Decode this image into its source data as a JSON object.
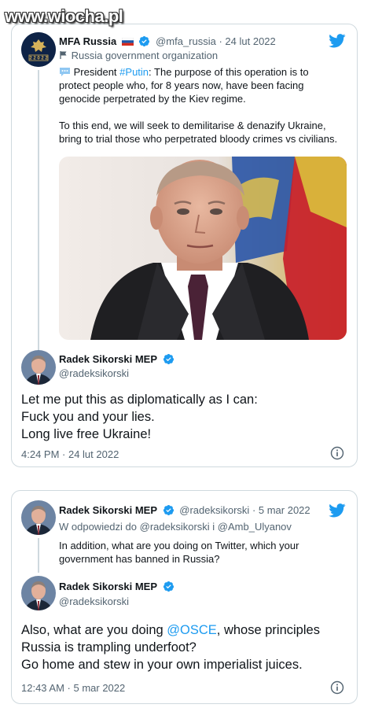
{
  "watermark": "www.wiocha.pl",
  "card1": {
    "quoted": {
      "name": "MFA Russia",
      "handle": "@mfa_russia",
      "date": "· 24 lut 2022",
      "label": "Russia government organization",
      "line1_prefix": "President ",
      "hashtag": "#Putin",
      "line1_suffix": ": The purpose of this operation is to",
      "line2": "protect people who, for 8 years now, have been facing",
      "line3": "genocide perpetrated by the Kiev regime.",
      "line4": "To this end, we will seek to demilitarise & denazify Ukraine,",
      "line5": "bring to trial those who perpetrated bloody crimes vs civilians."
    },
    "reply": {
      "name": "Radek Sikorski MEP",
      "handle": "@radeksikorski",
      "line1": "Let me put this as diplomatically as I can:",
      "line2": "Fuck you and your lies.",
      "line3": "Long live free Ukraine!",
      "timestamp": "4:24 PM · 24 lut 2022"
    }
  },
  "card2": {
    "quoted": {
      "name": "Radek Sikorski MEP",
      "handle": "@radeksikorski",
      "date": "· 5 mar 2022",
      "replying_prefix": "W odpowiedzi do ",
      "replying_handles": "@radeksikorski i @Amb_Ulyanov",
      "line1": "In addition, what are you doing on Twitter, which your",
      "line2": "government has banned in Russia?"
    },
    "reply": {
      "name": "Radek Sikorski MEP",
      "handle": "@radeksikorski",
      "line1_prefix": "Also, what are you doing ",
      "mention": "@OSCE",
      "line1_suffix": ", whose principles",
      "line2": "Russia is trampling underfoot?",
      "line3": "Go home and stew in your own imperialist juices.",
      "timestamp": "12:43 AM · 5 mar 2022"
    }
  },
  "colors": {
    "accent": "#1d9bf0",
    "text": "#0f1419",
    "muted": "#536471",
    "border": "#cfd9de"
  },
  "icons": [
    "twitter-bird-icon",
    "verified-badge-icon",
    "russian-flag-icon",
    "government-flag-icon",
    "speech-bubble-icon",
    "info-icon"
  ]
}
